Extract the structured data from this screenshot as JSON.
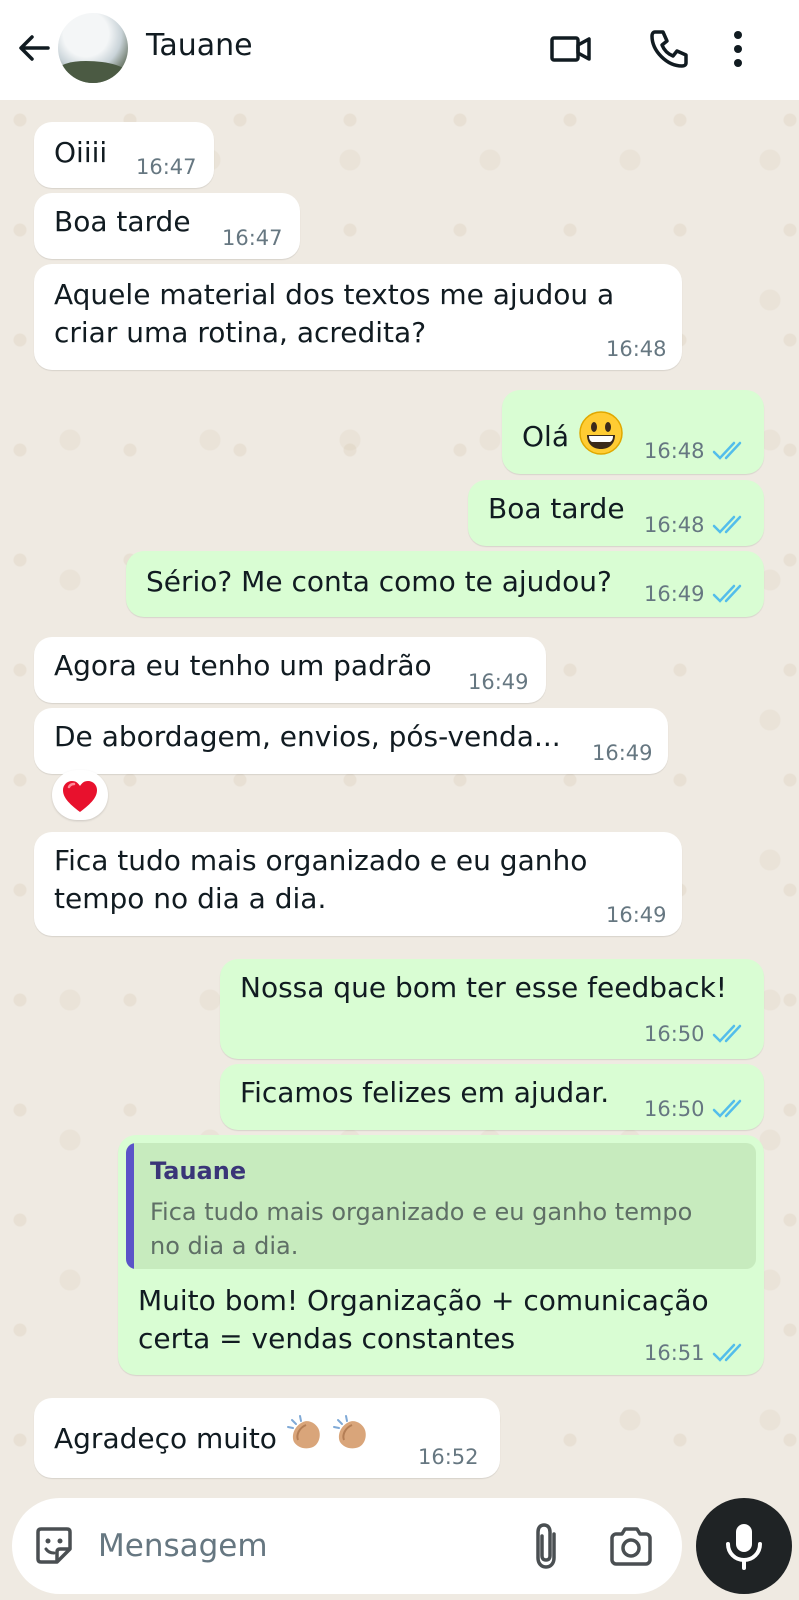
{
  "header": {
    "contact_name": "Tauane",
    "icons": [
      "back-arrow-icon",
      "video-call-icon",
      "phone-icon",
      "more-vert-icon"
    ]
  },
  "messages": [
    {
      "dir": "in",
      "text": "Oiiii",
      "time": "16:47"
    },
    {
      "dir": "in",
      "text": "Boa tarde",
      "time": "16:47"
    },
    {
      "dir": "in",
      "lines": [
        "Aquele material dos textos me ajudou a",
        "criar uma rotina, acredita?"
      ],
      "time": "16:48"
    },
    {
      "dir": "out",
      "text": "Olá",
      "emoji": "grinning-face",
      "time": "16:48",
      "status": "read"
    },
    {
      "dir": "out",
      "text": "Boa tarde",
      "time": "16:48",
      "status": "read"
    },
    {
      "dir": "out",
      "text": "Sério? Me conta como te ajudou?",
      "time": "16:49",
      "status": "read"
    },
    {
      "dir": "in",
      "text": "Agora eu tenho um padrão",
      "time": "16:49"
    },
    {
      "dir": "in",
      "text": "De abordagem, envios, pós-venda...",
      "time": "16:49",
      "reaction": "red-heart"
    },
    {
      "dir": "in",
      "lines": [
        "Fica tudo mais organizado e eu ganho",
        "tempo no dia a dia."
      ],
      "time": "16:49"
    },
    {
      "dir": "out",
      "text": "Nossa que bom ter esse feedback!",
      "time": "16:50",
      "status": "read"
    },
    {
      "dir": "out",
      "text": "Ficamos felizes em ajudar.",
      "time": "16:50",
      "status": "read"
    },
    {
      "dir": "out",
      "quote": {
        "author": "Tauane",
        "lines": [
          "Fica tudo mais organizado e eu ganho tempo",
          "no dia a dia."
        ]
      },
      "lines": [
        "Muito bom! Organização + comunicação",
        "certa = vendas constantes"
      ],
      "time": "16:51",
      "status": "read"
    },
    {
      "dir": "in",
      "text": "Agradeço muito",
      "emoji": "clapping-hands x2",
      "time": "16:52"
    }
  ],
  "composer": {
    "placeholder": "Mensagem",
    "icons": [
      "sticker-icon",
      "attach-icon",
      "camera-icon",
      "mic-icon"
    ]
  },
  "colors": {
    "incoming_bubble": "#ffffff",
    "outgoing_bubble": "#d9fdd3",
    "read_ticks": "#53bdeb",
    "chat_background": "#efeae2",
    "quote_bar": "#5b53c8"
  }
}
